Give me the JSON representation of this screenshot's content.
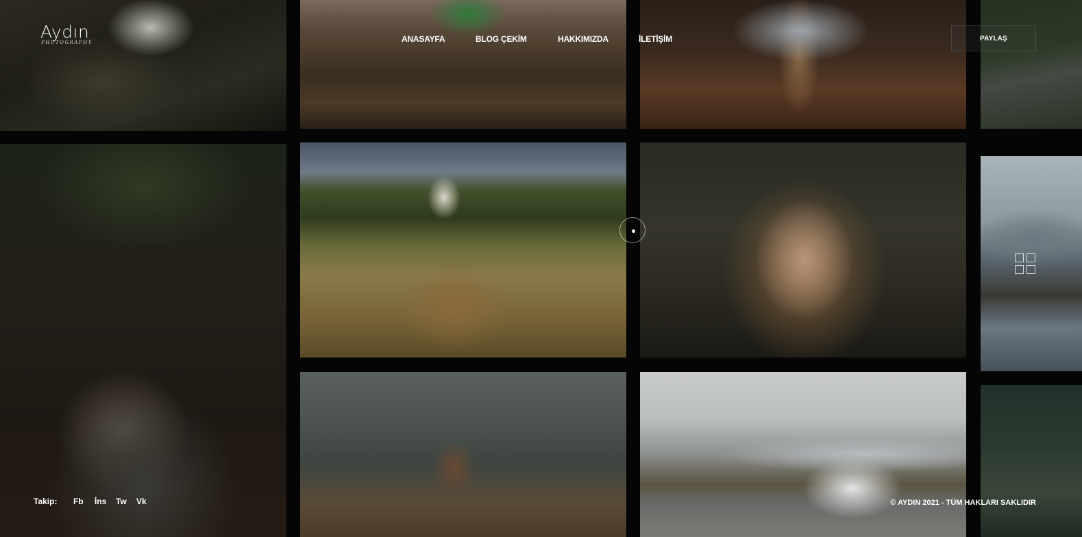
{
  "brand": {
    "name": "Aydın",
    "tagline": "PHOTOGRAPHY"
  },
  "nav": [
    {
      "label": "ANASAYFA"
    },
    {
      "label": "BLOG ÇEKİM"
    },
    {
      "label": "HAKKIMIZDA"
    },
    {
      "label": "İLETİŞİM"
    }
  ],
  "share_label": "PAYLAŞ",
  "follow": {
    "label": "Takip:",
    "links": [
      "Fb",
      "İns",
      "Tw",
      "Vk"
    ]
  },
  "copyright": "© AYDIN 2021 - TÜM HAKLARI SAKLIDIR",
  "gallery_icons": [
    "grid-icon",
    "cursor-ring-icon"
  ]
}
